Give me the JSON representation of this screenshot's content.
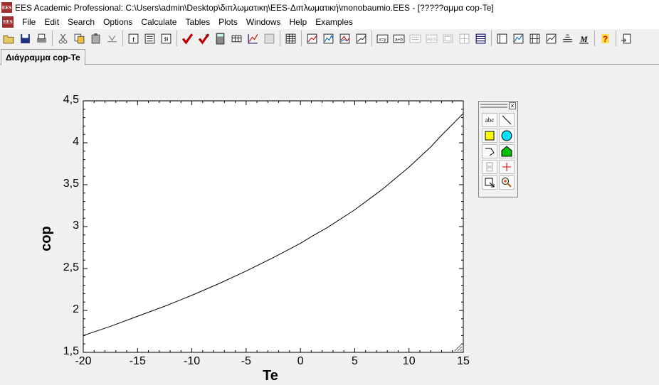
{
  "window": {
    "app_icon": "EES",
    "title": "EES Academic Professional:  C:\\Users\\admin\\Desktop\\διπλωματικη\\EES-Διπλωματική\\monobaumio.EES - [?????αμμα cop-Te]"
  },
  "menu": [
    "File",
    "Edit",
    "Search",
    "Options",
    "Calculate",
    "Tables",
    "Plots",
    "Windows",
    "Help",
    "Examples"
  ],
  "toolbar_icons": [
    "open-icon",
    "save-icon",
    "print-icon",
    "cut-icon",
    "copy-icon",
    "paste-icon",
    "check-icon",
    "new-icon",
    "info-icon",
    "variable-info-icon",
    "units-icon",
    "check-units-icon",
    "check-units-all-icon",
    "calculator-icon",
    "solve-table-icon",
    "plot-icon",
    "min-max-icon",
    "parametric-table-icon",
    "lookup-table-icon",
    "xy-plot-icon",
    "overlay-plot-icon",
    "3d-plot-icon",
    "plot-window-icon",
    "xy-table-icon",
    "format-table-icon",
    "table-icon",
    "results-table-icon",
    "integral-table-icon",
    "arrays-table-icon",
    "equation-icon",
    "formatted-eq-icon",
    "diagram-icon",
    "solution-icon",
    "residuals-icon",
    "report-icon",
    "macro-icon",
    "help-icon",
    "exit-icon"
  ],
  "tab": {
    "label": "Διάγραμμα cop-Te"
  },
  "chart_data": {
    "type": "line",
    "title": "",
    "xlabel": "Te",
    "ylabel": "cop",
    "xlim": [
      -20,
      15
    ],
    "ylim": [
      1.5,
      4.5
    ],
    "xticks": [
      "-20",
      "-15",
      "-10",
      "-5",
      "0",
      "5",
      "10",
      "15"
    ],
    "yticks": [
      "1,5",
      "2",
      "2,5",
      "3",
      "3,5",
      "4",
      "4,5"
    ],
    "xtick_values": [
      -20,
      -15,
      -10,
      -5,
      0,
      5,
      10,
      15
    ],
    "ytick_values": [
      1.5,
      2,
      2.5,
      3,
      3.5,
      4,
      4.5
    ],
    "grid": false,
    "series": [
      {
        "x": [
          -20,
          -17.5,
          -15,
          -12.5,
          -10,
          -7.5,
          -5,
          -2.5,
          0,
          1,
          2.5,
          5,
          7.5,
          10,
          12,
          13,
          15
        ],
        "y": [
          1.7,
          1.81,
          1.93,
          2.05,
          2.18,
          2.32,
          2.47,
          2.63,
          2.8,
          2.88,
          2.99,
          3.2,
          3.44,
          3.71,
          3.95,
          4.09,
          4.35
        ]
      }
    ]
  },
  "palette": {
    "title": "",
    "tools": [
      "text-tool-icon",
      "line-tool-icon",
      "rectangle-tool-icon",
      "circle-tool-icon",
      "polyline-tool-icon",
      "polygon-tool-icon",
      "group-tool-icon",
      "crosshair-tool-icon",
      "move-tool-icon",
      "zoom-tool-icon"
    ],
    "text_tool_label": "abc"
  }
}
